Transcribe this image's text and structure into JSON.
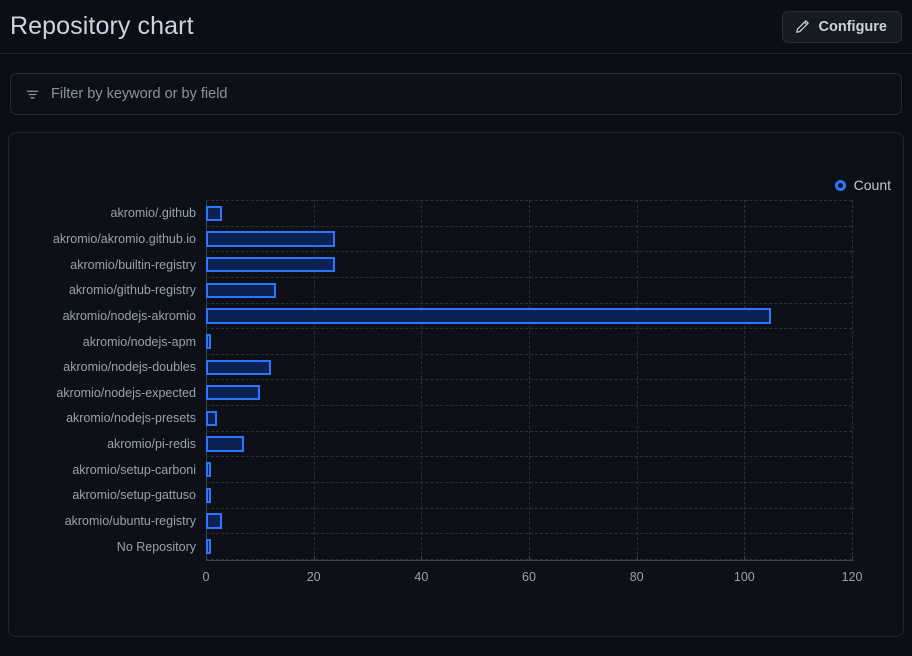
{
  "header": {
    "title": "Repository chart",
    "configure_label": "Configure",
    "pencil_icon": "pencil-icon"
  },
  "filter": {
    "placeholder": "Filter by keyword or by field",
    "value": "",
    "icon": "filter-icon"
  },
  "legend": {
    "label": "Count",
    "marker_color": "#2d74ff",
    "position": "top-right"
  },
  "colors": {
    "page_background": "#0b0e14",
    "panel_background": "#0d1117",
    "panel_border": "#21262d",
    "bar_fill": "#0c2252",
    "bar_stroke": "#2d74ff",
    "grid": "#2a3039",
    "axis": "#3d444d",
    "text_primary": "#ccd3e0",
    "text_muted": "#99a1ad"
  },
  "chart_data": {
    "type": "bar",
    "orientation": "horizontal",
    "title": "",
    "xlabel": "",
    "ylabel": "",
    "xlim": [
      0,
      120
    ],
    "xticks": [
      0,
      20,
      40,
      60,
      80,
      100,
      120
    ],
    "grid": true,
    "legend": [
      "Count"
    ],
    "categories": [
      "akromio/.github",
      "akromio/akromio.github.io",
      "akromio/builtin-registry",
      "akromio/github-registry",
      "akromio/nodejs-akromio",
      "akromio/nodejs-apm",
      "akromio/nodejs-doubles",
      "akromio/nodejs-expected",
      "akromio/nodejs-presets",
      "akromio/pi-redis",
      "akromio/setup-carboni",
      "akromio/setup-gattuso",
      "akromio/ubuntu-registry",
      "No Repository"
    ],
    "series": [
      {
        "name": "Count",
        "values": [
          3,
          24,
          24,
          13,
          105,
          1,
          12,
          10,
          2,
          7,
          1,
          1,
          3,
          1
        ]
      }
    ]
  }
}
